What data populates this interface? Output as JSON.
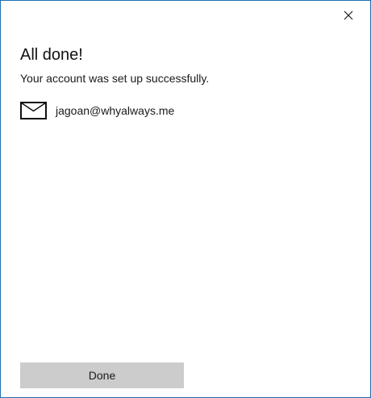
{
  "dialog": {
    "close_icon": "close-icon",
    "heading": "All done!",
    "message": "Your account was set up successfully.",
    "account": {
      "icon": "mail-icon",
      "email": "jagoan@whyalways.me"
    },
    "done_label": "Done"
  },
  "colors": {
    "border": "#1f6fb2",
    "button_bg": "#cccccc",
    "text": "#1a1a1a",
    "background": "#ffffff"
  }
}
